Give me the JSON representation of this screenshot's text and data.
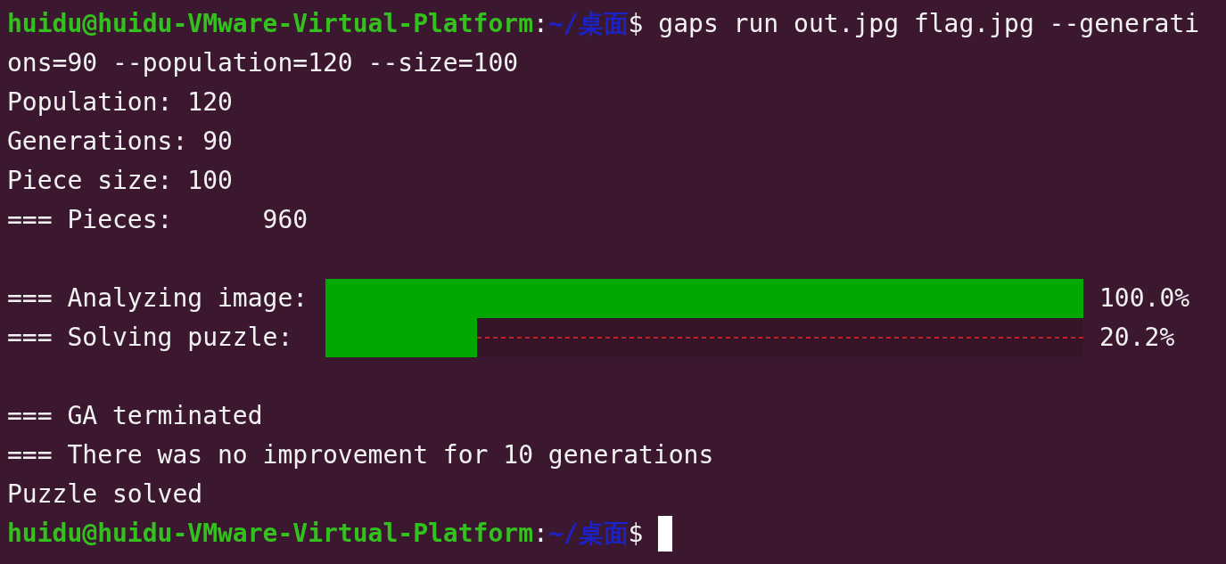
{
  "terminal": {
    "lines": [
      {
        "kind": "prompt",
        "user_host": "huidu@huidu-VMware-Virtual-Platform",
        "separator": ":",
        "path": "~/桌面",
        "sign": "$",
        "command": " gaps run out.jpg flag.jpg --generati"
      },
      {
        "kind": "text",
        "text": "ons=90 --population=120 --size=100"
      },
      {
        "kind": "text",
        "text": "Population: 120"
      },
      {
        "kind": "text",
        "text": "Generations: 90"
      },
      {
        "kind": "text",
        "text": "Piece size: 100"
      },
      {
        "kind": "text",
        "text": "=== Pieces:      960"
      },
      {
        "kind": "blank"
      },
      {
        "kind": "progress",
        "label": "=== Analyzing image:",
        "level": 1.0,
        "reading": "100.0%"
      },
      {
        "kind": "progress",
        "label": "=== Solving puzzle:",
        "level": 0.2,
        "reading": "20.2%"
      },
      {
        "kind": "blank"
      },
      {
        "kind": "text",
        "text": "=== GA terminated"
      },
      {
        "kind": "text",
        "text": "=== There was no improvement for 10 generations"
      },
      {
        "kind": "text",
        "text": "Puzzle solved"
      },
      {
        "kind": "prompt",
        "user_host": "huidu@huidu-VMware-Virtual-Platform",
        "separator": ":",
        "path": "~/桌面",
        "sign": "$",
        "cursor": true
      }
    ]
  }
}
